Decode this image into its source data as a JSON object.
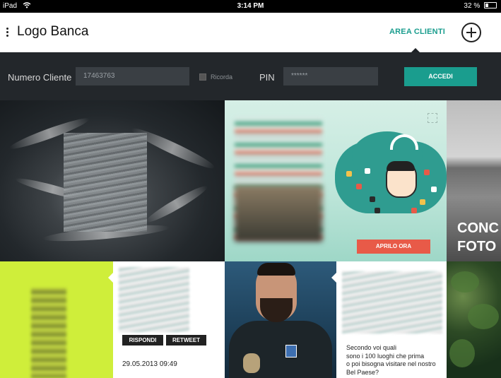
{
  "status_bar": {
    "device": "iPad",
    "time": "3:14 PM",
    "battery": "32 %"
  },
  "header": {
    "logo": "Logo Banca",
    "area_clienti": "AREA CLIENTI"
  },
  "login": {
    "numero_cliente_label": "Numero Cliente",
    "numero_cliente_value": "17463763",
    "ricorda_label": "Ricorda",
    "pin_label": "PIN",
    "pin_value": "******",
    "accedi_label": "ACCEDI"
  },
  "tiles": {
    "promo": {
      "button": "APRILO ORA"
    },
    "lake": {
      "text": "CONC\nFOTO"
    },
    "tweet1": {
      "reply": "RISPONDI",
      "retweet": "RETWEET",
      "date": "29.05.2013 09:49"
    },
    "tweet2": {
      "text": "Secondo voi quali\nsono i 100 luoghi che prima\no poi bisogna visitare nel nostro\nBel Paese?"
    }
  },
  "colors": {
    "accent": "#1a9d8e",
    "promo_button": "#e85a48",
    "lime": "#cfee3a"
  }
}
